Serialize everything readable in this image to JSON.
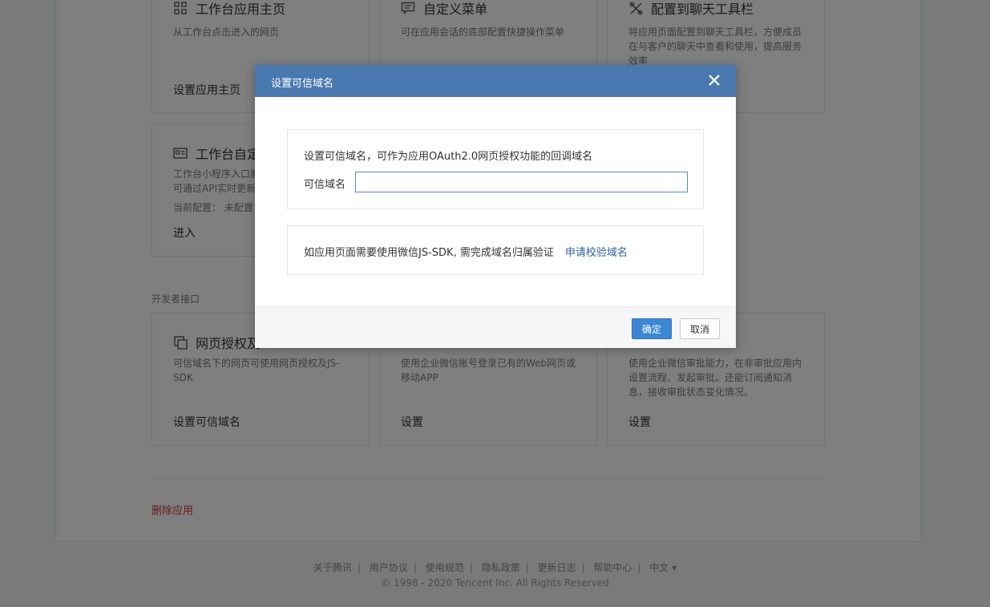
{
  "cards_row1": [
    {
      "title": "工作台应用主页",
      "desc": "从工作台点击进入的网页",
      "action": "设置应用主页",
      "icon": "grid-icon"
    },
    {
      "title": "自定义菜单",
      "desc": "可在应用会话的底部配置快捷操作菜单",
      "action": "",
      "icon": "menu-icon"
    },
    {
      "title": "配置到聊天工具栏",
      "desc": "将应用页面配置到聊天工具栏，方便成员在与客户的聊天中查看和使用，提高服务效率",
      "action": "",
      "icon": "tool-icon"
    }
  ],
  "cards_row2": [
    {
      "title": "工作台自定",
      "desc": "工作台小程序入口展\n可通过API实时更新",
      "meta_label": "当前配置：",
      "meta_value": "未配置",
      "action": "进入",
      "icon": "card-icon"
    }
  ],
  "section_label": "开发者接口",
  "cards_row3": [
    {
      "title": "网页授权及",
      "desc": "可信域名下的网页可使用网页授权及JS-SDK",
      "action": "设置可信域名",
      "icon": "copy-icon"
    },
    {
      "title": "",
      "desc": "使用企业微信账号登录已有的Web网页或移动APP",
      "action": "设置",
      "icon": ""
    },
    {
      "title": "",
      "desc": "使用企业微信审批能力，在非审批应用内设置流程、发起审批。还能订阅通知消息，接收审批状态变化情况。",
      "action": "设置",
      "icon": ""
    }
  ],
  "delete_label": "删除应用",
  "footer": {
    "links": [
      "关于腾讯",
      "用户协议",
      "使用规范",
      "隐私政策",
      "更新日志",
      "帮助中心",
      "中文 ▾"
    ],
    "copyright": "© 1998 - 2020 Tencent Inc. All Rights Reserved"
  },
  "dialog": {
    "title": "设置可信域名",
    "intro": "设置可信域名，可作为应用OAuth2.0网页授权功能的回调域名",
    "field_label": "可信域名",
    "field_value": "",
    "jssdk_text": "如应用页面需要使用微信JS-SDK, 需完成域名归属验证",
    "jssdk_link": "申请校验域名",
    "ok_label": "确定",
    "cancel_label": "取消"
  },
  "colors": {
    "header": "#4a79b0",
    "primary_button": "#3c87d4",
    "link": "#2b5f9e",
    "danger": "#d2383b"
  }
}
